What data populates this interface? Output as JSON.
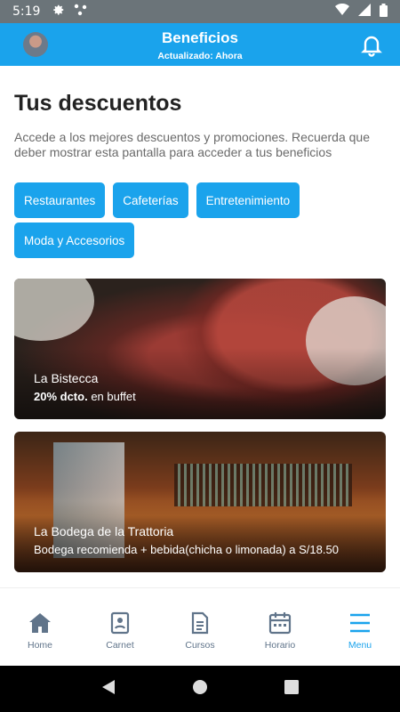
{
  "status": {
    "time": "5:19"
  },
  "appbar": {
    "title": "Beneficios",
    "subtitle": "Actualizado: Ahora"
  },
  "main": {
    "heading": "Tus descuentos",
    "description": "Accede a los mejores descuentos y promociones. Recuerda que deber mostrar esta pantalla para acceder a tus beneficios",
    "categories": [
      "Restaurantes",
      "Cafeterías",
      "Entretenimiento",
      "Moda y Accesorios"
    ],
    "cards": [
      {
        "name": "La Bistecca",
        "discount": "20% dcto.",
        "detail": "en buffet"
      },
      {
        "name": "La Bodega de la Trattoria",
        "discount": "",
        "detail": "Bodega recomienda + bebida(chicha o limonada) a S/18.50"
      }
    ]
  },
  "bottom_nav": [
    {
      "label": "Home",
      "icon": "home-icon"
    },
    {
      "label": "Carnet",
      "icon": "id-card-icon"
    },
    {
      "label": "Cursos",
      "icon": "document-icon"
    },
    {
      "label": "Horario",
      "icon": "calendar-icon"
    },
    {
      "label": "Menu",
      "icon": "menu-icon",
      "active": true
    }
  ],
  "colors": {
    "accent": "#1aa3ec",
    "nav_inactive": "#60748a",
    "statusbar": "#6b7479"
  }
}
